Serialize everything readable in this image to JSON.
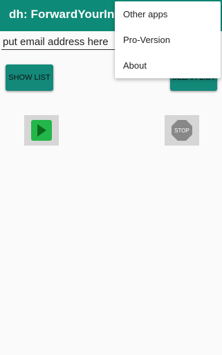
{
  "app_bar": {
    "title": "dh: ForwardYourInform",
    "color": "#0e8a78"
  },
  "email": {
    "value": "",
    "placeholder": "put email address here"
  },
  "buttons": {
    "show_list": "SHOW LIST",
    "clear_list": "CLEAR LIST",
    "stop_label": "STOP",
    "color": "#13897a"
  },
  "icons": {
    "play": "play-icon",
    "stop": "stop-icon"
  },
  "menu": {
    "items": [
      {
        "label": "Other apps"
      },
      {
        "label": "Pro-Version"
      },
      {
        "label": "About"
      }
    ]
  }
}
